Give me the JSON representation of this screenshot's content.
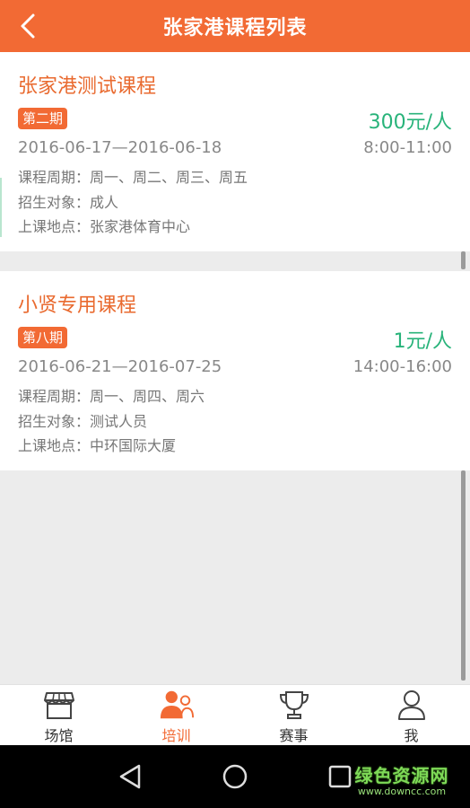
{
  "header": {
    "title": "张家港课程列表"
  },
  "courses": [
    {
      "name": "张家港测试课程",
      "period": "第二期",
      "price": "300元/人",
      "dates": "2016-06-17—2016-06-18",
      "time": "8:00-11:00",
      "cycle": "课程周期：周一、周二、周三、周五",
      "target": "招生对象：成人",
      "location": "上课地点：张家港体育中心"
    },
    {
      "name": "小贤专用课程",
      "period": "第八期",
      "price": "1元/人",
      "dates": "2016-06-21—2016-07-25",
      "time": "14:00-16:00",
      "cycle": "课程周期：周一、周四、周六",
      "target": "招生对象：测试人员",
      "location": "上课地点：中环国际大厦"
    }
  ],
  "tabs": [
    {
      "label": "场馆",
      "icon": "venue-icon",
      "active": false
    },
    {
      "label": "培训",
      "icon": "training-icon",
      "active": true
    },
    {
      "label": "赛事",
      "icon": "trophy-icon",
      "active": false
    },
    {
      "label": "我",
      "icon": "user-icon",
      "active": false
    }
  ],
  "watermark": {
    "main": "绿色资源网",
    "sub": "www.downcc.com"
  },
  "colors": {
    "accent": "#f26a34",
    "price": "#28b37a",
    "muted": "#888888"
  }
}
